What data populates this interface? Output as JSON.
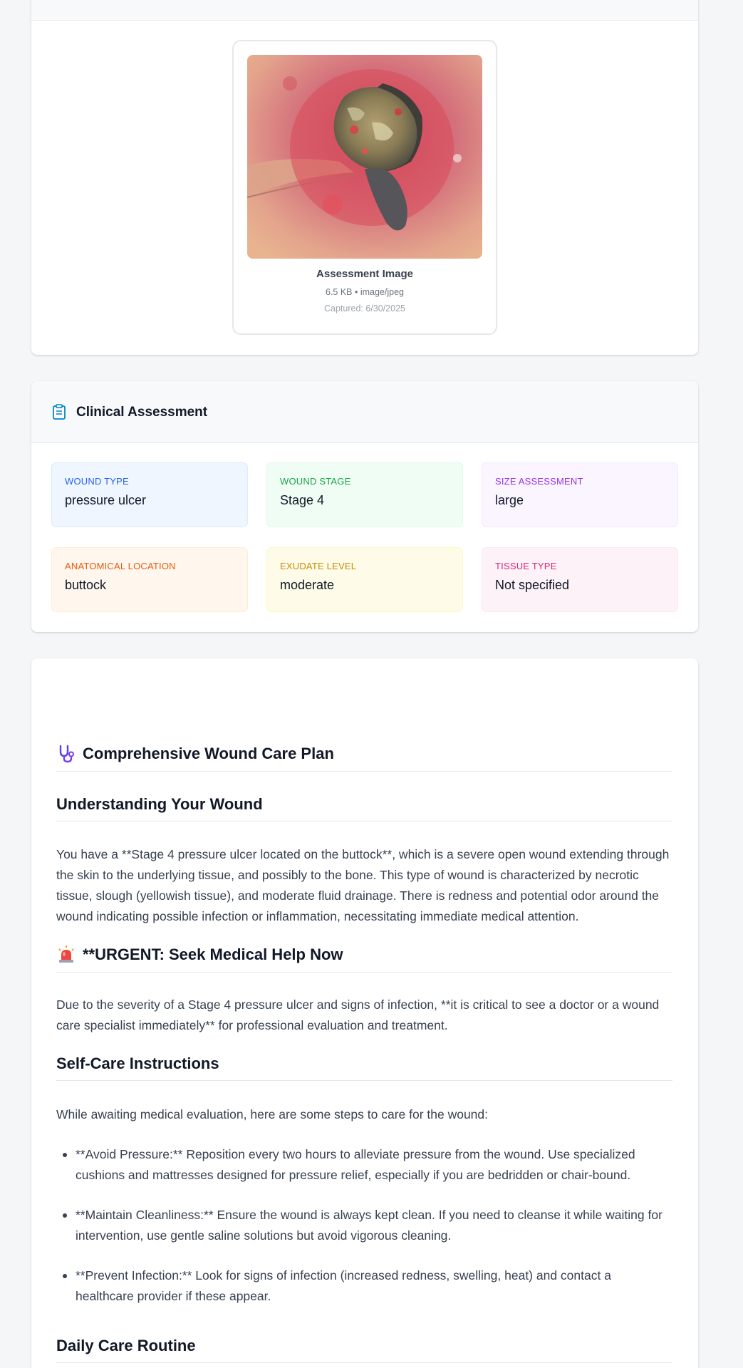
{
  "image_card": {
    "title": "Assessment Image",
    "meta": "6.5 KB • image/jpeg",
    "captured": "Captured: 6/30/2025",
    "image_icon": "wound-photo"
  },
  "assessment": {
    "title": "Clinical Assessment",
    "icon": "clipboard-icon",
    "tiles": [
      {
        "label": "WOUND TYPE",
        "value": "pressure ulcer"
      },
      {
        "label": "WOUND STAGE",
        "value": "Stage 4"
      },
      {
        "label": "SIZE ASSESSMENT",
        "value": "large"
      },
      {
        "label": "ANATOMICAL LOCATION",
        "value": "buttock"
      },
      {
        "label": "EXUDATE LEVEL",
        "value": "moderate"
      },
      {
        "label": "TISSUE TYPE",
        "value": "Not specified"
      }
    ],
    "colors": {
      "wound_type": "#2563eb",
      "wound_stage": "#16a34a",
      "size": "#9333ea",
      "location": "#ea580c",
      "exudate": "#ca8a04",
      "tissue": "#db2777"
    }
  },
  "care_plan": {
    "heading": "Comprehensive Wound Care Plan",
    "heading_icon": "stethoscope-icon",
    "understanding_heading": "Understanding Your Wound",
    "understanding_text": "You have a **Stage 4 pressure ulcer located on the buttock**, which is a severe open wound extending through the skin to the underlying tissue, and possibly to the bone. This type of wound is characterized by necrotic tissue, slough (yellowish tissue), and moderate fluid drainage. There is redness and potential odor around the wound indicating possible infection or inflammation, necessitating immediate medical attention.",
    "urgent_heading": "**URGENT: Seek Medical Help Now",
    "urgent_icon": "siren-icon",
    "urgent_text": "Due to the severity of a Stage 4 pressure ulcer and signs of infection, **it is critical to see a doctor or a wound care specialist immediately** for professional evaluation and treatment.",
    "selfcare_heading": "Self-Care Instructions",
    "selfcare_intro": "While awaiting medical evaluation, here are some steps to care for the wound:",
    "selfcare_items": [
      "**Avoid Pressure:** Reposition every two hours to alleviate pressure from the wound. Use specialized cushions and mattresses designed for pressure relief, especially if you are bedridden or chair-bound.",
      "**Maintain Cleanliness:** Ensure the wound is always kept clean. If you need to cleanse it while waiting for intervention, use gentle saline solutions but avoid vigorous cleaning.",
      "**Prevent Infection:** Look for signs of infection (increased redness, swelling, heat) and contact a healthcare provider if these appear."
    ],
    "daily_heading": "Daily Care Routine"
  }
}
